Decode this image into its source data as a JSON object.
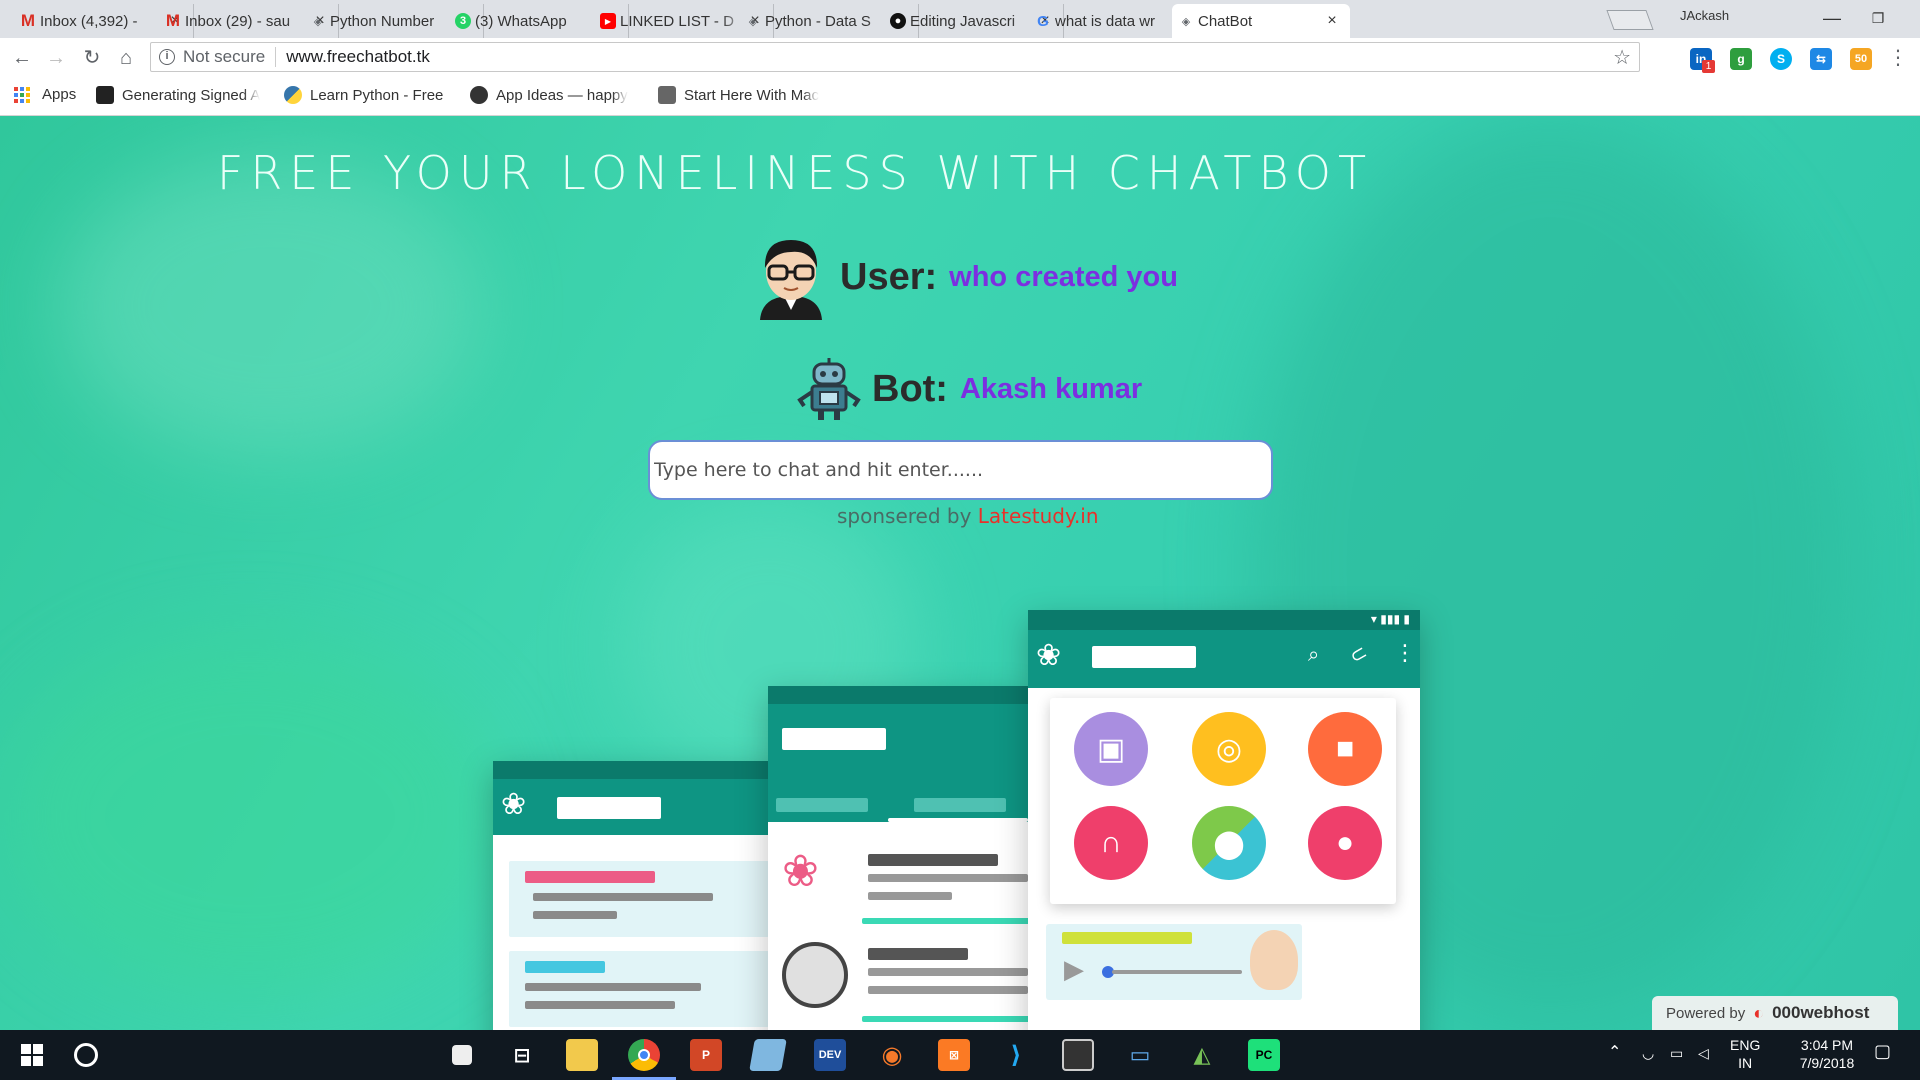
{
  "browser": {
    "tabs": [
      {
        "title": "Inbox (4,392) - ",
        "icon": "gmail-icon",
        "color": "#d93025"
      },
      {
        "title": "Inbox (29) - sau",
        "icon": "gmail-icon",
        "color": "#d93025"
      },
      {
        "title": "Python Number",
        "icon": "site-icon",
        "color": "#5f6368"
      },
      {
        "title": "(3) WhatsApp",
        "icon": "whatsapp-icon",
        "color": "#25d366"
      },
      {
        "title": "LINKED LIST - D",
        "icon": "youtube-icon",
        "color": "#ff0000"
      },
      {
        "title": "Python - Data S",
        "icon": "site-icon",
        "color": "#5f6368"
      },
      {
        "title": "Editing Javascri",
        "icon": "github-icon",
        "color": "#111111"
      },
      {
        "title": "what is data wr",
        "icon": "google-icon",
        "color": "#4285f4"
      },
      {
        "title": "ChatBot",
        "icon": "site-icon",
        "color": "#5f6368"
      }
    ],
    "profile_name": "JAckash",
    "whatsapp_badge": "3",
    "security_label": "Not secure",
    "url": "www.freechatbot.tk",
    "extensions": [
      {
        "name": "linkedin-extension-icon",
        "label": "in",
        "color": "#0a66c2",
        "badge": "1"
      },
      {
        "name": "grammar-extension-icon",
        "label": "g",
        "color": "#2e9e3e"
      },
      {
        "name": "skype-extension-icon",
        "label": "S",
        "color": "#00aff0"
      },
      {
        "name": "sync-extension-icon",
        "label": "⇆",
        "color": "#1e88e5"
      },
      {
        "name": "fifty-extension-icon",
        "label": "50",
        "color": "#f5a623"
      }
    ]
  },
  "bookmarks": [
    {
      "label": "Apps"
    },
    {
      "label": "Generating Signed A"
    },
    {
      "label": "Learn Python - Free"
    },
    {
      "label": "App Ideas — happy"
    },
    {
      "label": "Start Here With Mac"
    }
  ],
  "page": {
    "headline": "FREE YOUR LONELINESS WITH CHATBOT",
    "user_label": "User:",
    "user_message": "who created you",
    "bot_label": "Bot:",
    "bot_message": "Akash kumar",
    "chat_placeholder": "Type here to chat and hit enter......",
    "sponsor_prefix": "sponsered by ",
    "sponsor_link": "Latestudy.in",
    "powered_by": "Powered by",
    "host_name": "000webhost",
    "colors": {
      "teal": "#3fd5b0",
      "accent_purple": "#7c2fe0",
      "sponsor_red": "#e8312a"
    }
  },
  "taskbar": {
    "apps": [
      {
        "name": "file-explorer-icon"
      },
      {
        "name": "chrome-icon"
      },
      {
        "name": "powerpoint-icon"
      },
      {
        "name": "notepad-icon"
      },
      {
        "name": "dev-cpp-icon"
      },
      {
        "name": "blender-icon"
      },
      {
        "name": "xampp-icon"
      },
      {
        "name": "vscode-icon"
      },
      {
        "name": "terminal-icon"
      },
      {
        "name": "remote-desktop-icon"
      },
      {
        "name": "android-studio-icon"
      },
      {
        "name": "pycharm-icon"
      }
    ],
    "language": "ENG",
    "region": "IN",
    "time": "3:04 PM",
    "date": "7/9/2018"
  }
}
